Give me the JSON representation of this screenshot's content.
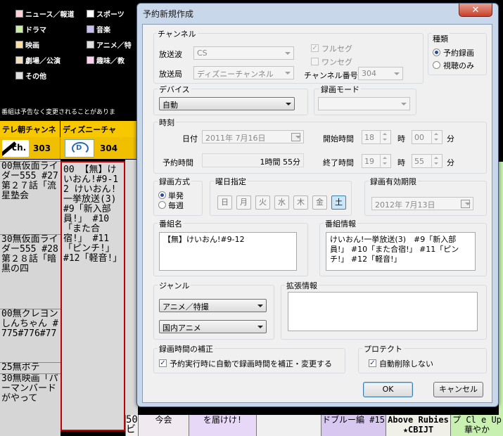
{
  "epg": {
    "legend": [
      {
        "label": "ニュース／報道",
        "color": "#ffd0d8"
      },
      {
        "label": "スポーツ",
        "color": "#ffffff"
      },
      {
        "label": "ドラマ",
        "color": "#c8f0a0"
      },
      {
        "label": "音楽",
        "color": "#c8c0f0"
      },
      {
        "label": "映画",
        "color": "#ffe0a0"
      },
      {
        "label": "アニメ／特",
        "color": "#e0e0e0"
      },
      {
        "label": "劇場／公演",
        "color": "#f0e0c0"
      },
      {
        "label": "趣味／教",
        "color": "#ffd0f0"
      },
      {
        "label": "その他",
        "color": "#e0e0e0"
      }
    ],
    "notice": "番組は予告なく変更されることがありま",
    "channels": [
      {
        "name": "テレ朝チャンネ",
        "number": "303",
        "logo": "ch."
      },
      {
        "name": "ディズニーチャ",
        "number": "304",
        "logo": "D"
      }
    ],
    "left_programs": [
      {
        "time": "00",
        "text": "無仮面ライダー555 #27 第２７話「流星塾会"
      },
      {
        "time": "30",
        "text": "無仮面ライダー555 #28 第２８話「暗黒の四"
      },
      {
        "time": "00",
        "text": "無クレヨンしんちゃん #775#776#77"
      },
      {
        "time": "25",
        "text": "無ポテ"
      },
      {
        "time": "30",
        "text": "無映画「パーマンバードがやって"
      }
    ],
    "selected_program": {
      "time": "00",
      "text": "【無】けいおん!#9-12 けいおん!一挙放送(3) #9「新入部員!」 #10「また合宿!」 #11「ピンチ!」 #12「軽音!」"
    },
    "bottom_items": [
      {
        "time": "50",
        "text": "銀河☆ネビ"
      },
      {
        "time": "",
        "text": "今会"
      },
      {
        "time": "",
        "text": "を届けけ!"
      },
      {
        "time": "",
        "text": "ドブルー編 #15"
      },
      {
        "time": "",
        "text": "Above Rubies ★CBIJT"
      },
      {
        "time": "",
        "text": "プ Cl e Up 華やか"
      }
    ]
  },
  "dialog": {
    "title": "予約新規作成",
    "close_symbol": "✕",
    "channel": {
      "group_label": "チャンネル",
      "broadcast_wave_label": "放送波",
      "broadcast_wave_value": "CS",
      "station_label": "放送局",
      "station_value": "ディズニーチャンネル",
      "fullseg_label": "フルセグ",
      "oneseg_label": "ワンセグ",
      "channel_number_label": "チャンネル番号",
      "channel_number_value": "304"
    },
    "kind": {
      "group_label": "種類",
      "options": [
        "予約録画",
        "視聴のみ"
      ],
      "selected": 0
    },
    "device": {
      "group_label": "デバイス",
      "value": "自動"
    },
    "record_mode": {
      "group_label": "録画モード",
      "value": ""
    },
    "time": {
      "group_label": "時刻",
      "date_label": "日付",
      "date_value": "2011年  7月16日",
      "start_label": "開始時間",
      "start_hour": "18",
      "start_min": "00",
      "end_label": "終了時間",
      "end_hour": "19",
      "end_min": "55",
      "hour_unit": "時",
      "min_unit": "分",
      "reserve_label": "予約時間",
      "duration_value": "1時間 55分"
    },
    "method": {
      "group_label": "録画方式",
      "options": [
        "単発",
        "毎週"
      ],
      "selected": 0
    },
    "weekday": {
      "group_label": "曜日指定",
      "days": [
        "日",
        "月",
        "火",
        "水",
        "木",
        "金",
        "土"
      ],
      "selected": 6
    },
    "expiry": {
      "group_label": "録画有効期限",
      "value": "2012年  7月13日"
    },
    "program_name": {
      "group_label": "番組名",
      "value": "【無】けいおん!#9-12"
    },
    "program_info": {
      "group_label": "番組情報",
      "value": "けいおん!一挙放送(3)　#9「新入部員!」 #10「また合宿!」 #11「ピンチ!」 #12「軽音!」"
    },
    "genre": {
      "group_label": "ジャンル",
      "primary": "アニメ／特撮",
      "secondary": "国内アニメ"
    },
    "extended": {
      "group_label": "拡張情報",
      "value": ""
    },
    "correction": {
      "group_label": "録画時間の補正",
      "checkbox_label": "予約実行時に自動で録画時間を補正・変更する",
      "checked": true
    },
    "protect": {
      "group_label": "プロテクト",
      "checkbox_label": "自動削除しない",
      "checked": true
    },
    "ok_label": "OK",
    "cancel_label": "キャンセル"
  }
}
